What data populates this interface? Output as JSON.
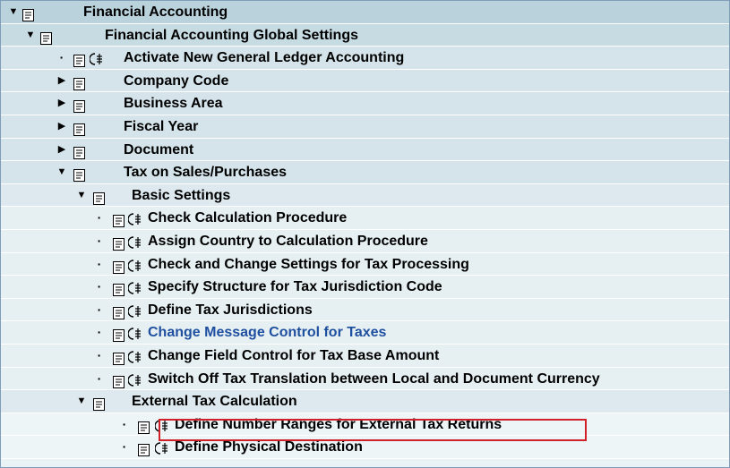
{
  "tree": {
    "rows": [
      {
        "label": "Financial Accounting",
        "level": 0,
        "kind": "folder",
        "expanded": true,
        "icons": [
          "triangle-down",
          "doc"
        ]
      },
      {
        "label": "Financial Accounting Global Settings",
        "level": 1,
        "kind": "folder",
        "expanded": true,
        "icons": [
          "triangle-down",
          "doc"
        ]
      },
      {
        "label": "Activate New General Ledger Accounting",
        "level": 2,
        "kind": "exec",
        "icons": [
          "dot",
          "doc",
          "clock-exec"
        ]
      },
      {
        "label": "Company Code",
        "level": 2,
        "kind": "folder",
        "expanded": false,
        "icons": [
          "triangle-right",
          "doc"
        ]
      },
      {
        "label": "Business Area",
        "level": 2,
        "kind": "folder",
        "expanded": false,
        "icons": [
          "triangle-right",
          "doc"
        ]
      },
      {
        "label": "Fiscal Year",
        "level": 2,
        "kind": "folder",
        "expanded": false,
        "icons": [
          "triangle-right",
          "doc"
        ]
      },
      {
        "label": "Document",
        "level": 2,
        "kind": "folder",
        "expanded": false,
        "icons": [
          "triangle-right",
          "doc"
        ]
      },
      {
        "label": "Tax on Sales/Purchases",
        "level": 2,
        "kind": "folder",
        "expanded": true,
        "icons": [
          "triangle-down",
          "doc"
        ]
      },
      {
        "label": "Basic Settings",
        "level": 3,
        "kind": "folder",
        "expanded": true,
        "icons": [
          "triangle-down",
          "doc"
        ]
      },
      {
        "label": "Check Calculation Procedure",
        "level": 4,
        "kind": "exec",
        "icons": [
          "dot",
          "doc",
          "clock-exec"
        ]
      },
      {
        "label": "Assign Country to Calculation Procedure",
        "level": 4,
        "kind": "exec",
        "icons": [
          "dot",
          "doc",
          "clock-exec"
        ]
      },
      {
        "label": "Check and Change Settings for Tax Processing",
        "level": 4,
        "kind": "exec",
        "icons": [
          "dot",
          "doc",
          "clock-exec"
        ]
      },
      {
        "label": "Specify Structure for Tax Jurisdiction Code",
        "level": 4,
        "kind": "exec",
        "icons": [
          "dot",
          "doc",
          "clock-exec"
        ]
      },
      {
        "label": "Define Tax Jurisdictions",
        "level": 4,
        "kind": "exec",
        "icons": [
          "dot",
          "doc",
          "clock-exec"
        ]
      },
      {
        "label": "Change Message Control for Taxes",
        "level": 4,
        "kind": "exec",
        "link": true,
        "icons": [
          "dot",
          "doc",
          "clock-exec"
        ]
      },
      {
        "label": "Change Field Control for Tax Base Amount",
        "level": 4,
        "kind": "exec",
        "icons": [
          "dot",
          "doc",
          "clock-exec"
        ]
      },
      {
        "label": "Switch Off Tax Translation between Local and Document Currency",
        "level": 4,
        "kind": "exec",
        "icons": [
          "dot",
          "doc",
          "clock-exec"
        ]
      },
      {
        "label": "External Tax Calculation",
        "level": 3,
        "kind": "folder",
        "expanded": true,
        "icons": [
          "triangle-down",
          "doc"
        ]
      },
      {
        "label": "Define Number Ranges for External Tax Returns",
        "level": 5,
        "kind": "exec",
        "highlighted": true,
        "icons": [
          "dot",
          "doc",
          "clock-exec"
        ]
      },
      {
        "label": "Define Physical Destination",
        "level": 5,
        "kind": "exec",
        "icons": [
          "dot",
          "doc",
          "clock-exec"
        ]
      }
    ]
  },
  "colors": {
    "highlight_border": "#d0202a",
    "link_text": "#1f4f9f",
    "tree_border": "#7f9db9"
  }
}
